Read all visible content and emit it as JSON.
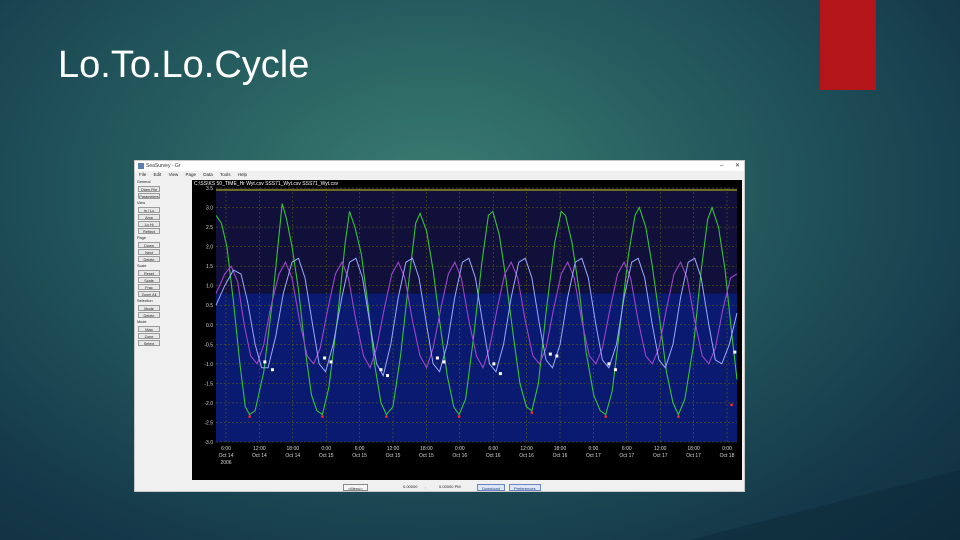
{
  "slide": {
    "title": "Lo.To.Lo.Cycle",
    "accent_color": "#b3151b"
  },
  "window": {
    "title": "SeaSurvey - Gr",
    "controls": [
      "–",
      "✕"
    ],
    "menu": [
      "File",
      "Edit",
      "View",
      "Page",
      "Data",
      "Tools",
      "Help"
    ]
  },
  "sidebar": {
    "groups": [
      {
        "label": "General",
        "buttons": [
          "Open File",
          "Parameters"
        ]
      },
      {
        "label": "View",
        "buttons": [
          "In | Lo",
          "Amp",
          "Lo Hi",
          "Reflect"
        ]
      },
      {
        "label": "Page",
        "buttons": [
          "Down",
          "Next",
          "Delete"
        ]
      },
      {
        "label": "Scale",
        "buttons": [
          "Reset",
          "Scale",
          "Frac",
          "Zoom All"
        ]
      },
      {
        "label": "Selection",
        "buttons": [
          "Mode",
          "Delete"
        ]
      },
      {
        "label": "Mode",
        "buttons": [
          "Map",
          "Zone",
          "Select"
        ]
      }
    ]
  },
  "status_bar": {
    "menu_button": "<Menu>",
    "value1": "0.00000",
    "separator": ",",
    "value2": "0.00000 PM",
    "button_blue1": "Download",
    "button_blue2": "Preferences"
  },
  "chart_data": {
    "type": "line",
    "title": "C:\\SS\\KS 50_TIME_Hr Wyt.csv  SSS71_Wyt.csv  SSS71_Wyt.csv",
    "ylim": [
      -3.0,
      3.5
    ],
    "yticks": [
      "3.5",
      "3.0",
      "2.5",
      "2.0",
      "1.5",
      "1.0",
      "0.5",
      "0.0",
      "-0.5",
      "-1.0",
      "-1.5",
      "-2.0",
      "-2.5",
      "-3.0"
    ],
    "xlim": [
      0,
      4.8
    ],
    "xtick_times": [
      "6:00",
      "12:00",
      "18:00",
      "0:00",
      "6:00",
      "12:00",
      "18:00",
      "0:00",
      "6:00",
      "12:00",
      "18:00",
      "0:00",
      "6:00",
      "12:00",
      "18:00",
      "0:00"
    ],
    "xtick_dates": [
      "Oct 14",
      "Oct 14",
      "Oct 14",
      "Oct 15",
      "Oct 15",
      "Oct 15",
      "Oct 15",
      "Oct 16",
      "Oct 16",
      "Oct 16",
      "Oct 16",
      "Oct 17",
      "Oct 17",
      "Oct 17",
      "Oct 17",
      "Oct 18"
    ],
    "x_year": "2006",
    "grid": true,
    "colors": {
      "background": "#000000",
      "lower_fill": "#0a1a70",
      "upper_fill": "#10103a",
      "grid": "#6a6a00",
      "ref_line": "#c8c800",
      "green": "#34c23a",
      "purple": "#9a45c8",
      "blue": "#9aa8ff",
      "marker": "#ffffff",
      "low_marker": "#ff2a2a",
      "axis_text": "#d8d8d8",
      "title_text": "#ffffff"
    },
    "ref_line_y": 3.45,
    "series": [
      {
        "color": "green",
        "points": [
          [
            0.0,
            2.8
          ],
          [
            0.05,
            2.6
          ],
          [
            0.1,
            2.0
          ],
          [
            0.16,
            0.6
          ],
          [
            0.22,
            -1.0
          ],
          [
            0.27,
            -2.1
          ],
          [
            0.31,
            -2.3
          ],
          [
            0.36,
            -2.2
          ],
          [
            0.44,
            -1.2
          ],
          [
            0.52,
            0.6
          ],
          [
            0.58,
            2.3
          ],
          [
            0.61,
            3.1
          ],
          [
            0.65,
            2.7
          ],
          [
            0.7,
            2.0
          ],
          [
            0.76,
            0.9
          ],
          [
            0.82,
            -0.6
          ],
          [
            0.88,
            -1.8
          ],
          [
            0.93,
            -2.2
          ],
          [
            0.98,
            -2.3
          ],
          [
            1.04,
            -1.6
          ],
          [
            1.12,
            0.2
          ],
          [
            1.19,
            2.1
          ],
          [
            1.23,
            2.9
          ],
          [
            1.28,
            2.5
          ],
          [
            1.34,
            1.8
          ],
          [
            1.4,
            0.5
          ],
          [
            1.46,
            -1.0
          ],
          [
            1.52,
            -2.0
          ],
          [
            1.57,
            -2.3
          ],
          [
            1.63,
            -2.1
          ],
          [
            1.7,
            -0.8
          ],
          [
            1.78,
            1.2
          ],
          [
            1.84,
            2.6
          ],
          [
            1.88,
            2.85
          ],
          [
            1.94,
            2.4
          ],
          [
            2.0,
            1.4
          ],
          [
            2.06,
            0.1
          ],
          [
            2.13,
            -1.3
          ],
          [
            2.19,
            -2.1
          ],
          [
            2.24,
            -2.3
          ],
          [
            2.3,
            -1.9
          ],
          [
            2.37,
            -0.4
          ],
          [
            2.45,
            1.6
          ],
          [
            2.51,
            2.8
          ],
          [
            2.55,
            2.9
          ],
          [
            2.61,
            2.3
          ],
          [
            2.67,
            1.2
          ],
          [
            2.74,
            -0.3
          ],
          [
            2.8,
            -1.5
          ],
          [
            2.86,
            -2.1
          ],
          [
            2.91,
            -2.2
          ],
          [
            2.97,
            -1.5
          ],
          [
            3.04,
            0.3
          ],
          [
            3.12,
            2.1
          ],
          [
            3.18,
            2.9
          ],
          [
            3.22,
            2.8
          ],
          [
            3.28,
            2.1
          ],
          [
            3.35,
            0.8
          ],
          [
            3.41,
            -0.7
          ],
          [
            3.48,
            -1.8
          ],
          [
            3.54,
            -2.2
          ],
          [
            3.59,
            -2.3
          ],
          [
            3.65,
            -1.7
          ],
          [
            3.72,
            -0.1
          ],
          [
            3.8,
            1.8
          ],
          [
            3.86,
            2.8
          ],
          [
            3.9,
            3.0
          ],
          [
            3.96,
            2.5
          ],
          [
            4.02,
            1.5
          ],
          [
            4.09,
            0.1
          ],
          [
            4.15,
            -1.2
          ],
          [
            4.21,
            -2.0
          ],
          [
            4.26,
            -2.3
          ],
          [
            4.32,
            -1.9
          ],
          [
            4.4,
            -0.5
          ],
          [
            4.47,
            1.4
          ],
          [
            4.53,
            2.7
          ],
          [
            4.57,
            3.0
          ],
          [
            4.63,
            2.5
          ],
          [
            4.69,
            1.4
          ],
          [
            4.75,
            -0.2
          ],
          [
            4.8,
            -1.4
          ]
        ]
      },
      {
        "color": "purple",
        "points": [
          [
            0.0,
            0.8
          ],
          [
            0.08,
            1.3
          ],
          [
            0.14,
            1.5
          ],
          [
            0.2,
            1.1
          ],
          [
            0.26,
            0.0
          ],
          [
            0.32,
            -0.8
          ],
          [
            0.38,
            -1.0
          ],
          [
            0.44,
            -0.5
          ],
          [
            0.5,
            0.4
          ],
          [
            0.58,
            1.3
          ],
          [
            0.64,
            1.6
          ],
          [
            0.7,
            1.2
          ],
          [
            0.77,
            0.1
          ],
          [
            0.84,
            -0.8
          ],
          [
            0.9,
            -1.0
          ],
          [
            0.96,
            -0.6
          ],
          [
            1.03,
            0.4
          ],
          [
            1.1,
            1.3
          ],
          [
            1.16,
            1.6
          ],
          [
            1.22,
            1.2
          ],
          [
            1.29,
            0.1
          ],
          [
            1.36,
            -0.8
          ],
          [
            1.42,
            -1.1
          ],
          [
            1.48,
            -0.6
          ],
          [
            1.55,
            0.4
          ],
          [
            1.62,
            1.3
          ],
          [
            1.68,
            1.6
          ],
          [
            1.74,
            1.2
          ],
          [
            1.81,
            0.1
          ],
          [
            1.88,
            -0.8
          ],
          [
            1.94,
            -1.1
          ],
          [
            2.0,
            -0.6
          ],
          [
            2.07,
            0.4
          ],
          [
            2.14,
            1.3
          ],
          [
            2.2,
            1.6
          ],
          [
            2.26,
            1.2
          ],
          [
            2.33,
            0.1
          ],
          [
            2.4,
            -0.8
          ],
          [
            2.46,
            -1.1
          ],
          [
            2.52,
            -0.6
          ],
          [
            2.59,
            0.4
          ],
          [
            2.66,
            1.3
          ],
          [
            2.72,
            1.6
          ],
          [
            2.78,
            1.2
          ],
          [
            2.85,
            0.1
          ],
          [
            2.92,
            -0.8
          ],
          [
            2.98,
            -1.0
          ],
          [
            3.04,
            -0.6
          ],
          [
            3.11,
            0.4
          ],
          [
            3.18,
            1.3
          ],
          [
            3.24,
            1.6
          ],
          [
            3.3,
            1.2
          ],
          [
            3.37,
            0.1
          ],
          [
            3.44,
            -0.8
          ],
          [
            3.5,
            -1.0
          ],
          [
            3.56,
            -0.6
          ],
          [
            3.63,
            0.4
          ],
          [
            3.7,
            1.3
          ],
          [
            3.76,
            1.6
          ],
          [
            3.82,
            1.2
          ],
          [
            3.89,
            0.1
          ],
          [
            3.96,
            -0.8
          ],
          [
            4.02,
            -1.0
          ],
          [
            4.08,
            -0.6
          ],
          [
            4.15,
            0.4
          ],
          [
            4.22,
            1.3
          ],
          [
            4.28,
            1.6
          ],
          [
            4.34,
            1.2
          ],
          [
            4.41,
            0.1
          ],
          [
            4.48,
            -0.8
          ],
          [
            4.54,
            -1.0
          ],
          [
            4.6,
            -0.6
          ],
          [
            4.67,
            0.4
          ],
          [
            4.74,
            1.2
          ],
          [
            4.8,
            1.3
          ]
        ]
      },
      {
        "color": "blue",
        "points": [
          [
            0.0,
            0.5
          ],
          [
            0.08,
            1.0
          ],
          [
            0.16,
            1.4
          ],
          [
            0.23,
            1.3
          ],
          [
            0.29,
            0.6
          ],
          [
            0.36,
            -0.5
          ],
          [
            0.42,
            -1.1
          ],
          [
            0.48,
            -1.1
          ],
          [
            0.55,
            -0.3
          ],
          [
            0.62,
            0.8
          ],
          [
            0.7,
            1.6
          ],
          [
            0.76,
            1.7
          ],
          [
            0.82,
            1.2
          ],
          [
            0.89,
            0.0
          ],
          [
            0.95,
            -1.0
          ],
          [
            1.01,
            -1.2
          ],
          [
            1.08,
            -0.5
          ],
          [
            1.16,
            0.7
          ],
          [
            1.23,
            1.6
          ],
          [
            1.29,
            1.7
          ],
          [
            1.35,
            1.2
          ],
          [
            1.42,
            0.0
          ],
          [
            1.48,
            -1.0
          ],
          [
            1.54,
            -1.3
          ],
          [
            1.61,
            -0.5
          ],
          [
            1.68,
            0.7
          ],
          [
            1.75,
            1.6
          ],
          [
            1.81,
            1.7
          ],
          [
            1.87,
            1.2
          ],
          [
            1.94,
            0.0
          ],
          [
            2.0,
            -1.0
          ],
          [
            2.06,
            -1.2
          ],
          [
            2.13,
            -0.5
          ],
          [
            2.2,
            0.7
          ],
          [
            2.27,
            1.6
          ],
          [
            2.33,
            1.7
          ],
          [
            2.39,
            1.2
          ],
          [
            2.46,
            0.0
          ],
          [
            2.52,
            -1.0
          ],
          [
            2.58,
            -1.2
          ],
          [
            2.65,
            -0.5
          ],
          [
            2.72,
            0.7
          ],
          [
            2.79,
            1.6
          ],
          [
            2.85,
            1.7
          ],
          [
            2.91,
            1.2
          ],
          [
            2.98,
            0.0
          ],
          [
            3.04,
            -0.9
          ],
          [
            3.1,
            -1.1
          ],
          [
            3.17,
            -0.5
          ],
          [
            3.24,
            0.7
          ],
          [
            3.31,
            1.6
          ],
          [
            3.37,
            1.7
          ],
          [
            3.43,
            1.2
          ],
          [
            3.5,
            0.0
          ],
          [
            3.56,
            -0.9
          ],
          [
            3.62,
            -1.1
          ],
          [
            3.69,
            -0.5
          ],
          [
            3.76,
            0.7
          ],
          [
            3.83,
            1.6
          ],
          [
            3.89,
            1.7
          ],
          [
            3.95,
            1.2
          ],
          [
            4.02,
            0.0
          ],
          [
            4.08,
            -0.9
          ],
          [
            4.14,
            -1.1
          ],
          [
            4.21,
            -0.5
          ],
          [
            4.28,
            0.7
          ],
          [
            4.35,
            1.6
          ],
          [
            4.41,
            1.7
          ],
          [
            4.47,
            1.2
          ],
          [
            4.54,
            0.0
          ],
          [
            4.6,
            -0.9
          ],
          [
            4.66,
            -1.0
          ],
          [
            4.73,
            -0.5
          ],
          [
            4.8,
            0.3
          ]
        ]
      }
    ],
    "markers_white": [
      [
        0.45,
        -0.95
      ],
      [
        0.52,
        -1.15
      ],
      [
        1.0,
        -0.85
      ],
      [
        1.06,
        -0.95
      ],
      [
        1.52,
        -1.15
      ],
      [
        1.58,
        -1.3
      ],
      [
        2.04,
        -0.85
      ],
      [
        2.1,
        -0.95
      ],
      [
        2.56,
        -1.0
      ],
      [
        2.62,
        -1.25
      ],
      [
        3.08,
        -0.75
      ],
      [
        3.14,
        -0.8
      ],
      [
        3.62,
        -1.0
      ],
      [
        3.68,
        -1.15
      ],
      [
        4.78,
        -0.7
      ]
    ],
    "markers_red": [
      [
        0.31,
        -2.35
      ],
      [
        0.98,
        -2.35
      ],
      [
        1.57,
        -2.35
      ],
      [
        2.24,
        -2.35
      ],
      [
        2.91,
        -2.25
      ],
      [
        3.59,
        -2.35
      ],
      [
        4.26,
        -2.35
      ],
      [
        4.75,
        -2.05
      ]
    ]
  }
}
